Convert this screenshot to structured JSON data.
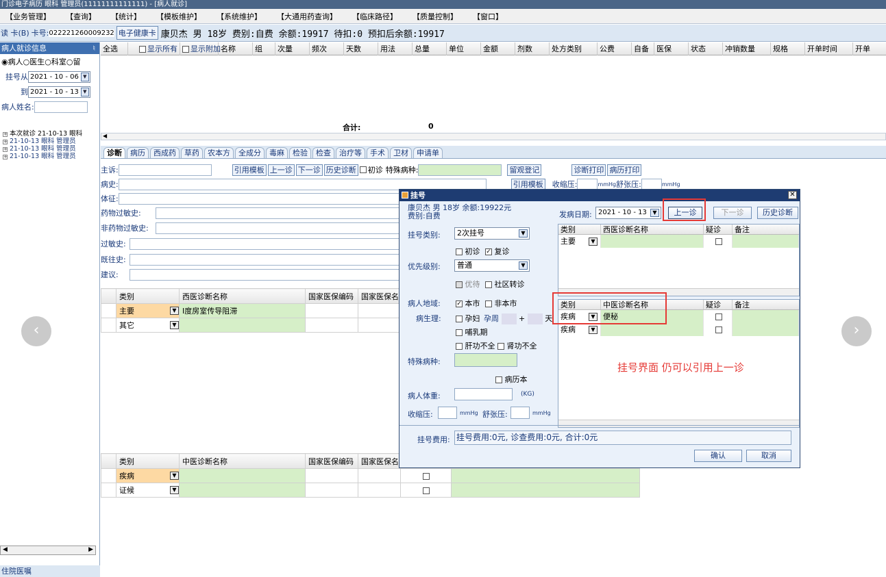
{
  "window": {
    "title": "门诊电子病历    眼科  管理员(11111111111111) - [病人就诊]"
  },
  "menu": [
    "【业务管理】",
    "【查询】",
    "【统计】",
    "【模板维护】",
    "【系统维护】",
    "【大通用药查询】",
    "【临床路径】",
    "【质量控制】",
    "【窗口】"
  ],
  "cardbar": {
    "read_card": "读 卡(B)",
    "card_no_label": "卡号:",
    "card_no": "022221260009232",
    "health_card_btn": "电子健康卡",
    "patient_info": "康贝杰 男 18岁 费别:自费 余额:19917 待扣:0 预扣后余额:19917"
  },
  "left": {
    "header": "病人就诊信息",
    "pin": "ᚑ",
    "radios": [
      "病人",
      "医生",
      "科室",
      "留"
    ],
    "reg_from_label": "挂号从",
    "reg_from": "2021 - 10 - 06",
    "reg_to_label": "到",
    "reg_to": "2021 - 10 - 13",
    "patient_name_label": "病人姓名:",
    "tree": [
      "本次就诊 21-10-13 眼科",
      "21-10-13 眼科 管理员",
      "21-10-13 眼科 管理员",
      "21-10-13 眼科 管理员"
    ],
    "footer": "住院医嘱"
  },
  "rx_grid": {
    "select_all": "全选",
    "show_all": "显示所有",
    "show_extra": "显示附加",
    "columns": [
      "名称",
      "组",
      "次量",
      "频次",
      "天数",
      "用法",
      "总量",
      "单位",
      "金额",
      "剂数",
      "处方类别",
      "公费",
      "自备",
      "医保",
      "状态",
      "冲销数量",
      "规格",
      "开单时间",
      "开单"
    ],
    "total_label": "合计:",
    "total_value": "0"
  },
  "tabs": [
    "诊断",
    "病历",
    "西成药",
    "草药",
    "农本方",
    "全成分",
    "毒麻",
    "检验",
    "检查",
    "治疗等",
    "手术",
    "卫材",
    "申请单"
  ],
  "form": {
    "complaint_label": "主诉:",
    "btn_template": "引用模板",
    "btn_prev": "上一诊",
    "btn_next": "下一诊",
    "btn_history": "历史诊断",
    "first_visit": "初诊",
    "special_label": "特殊病种:",
    "btn_observe": "留观登记",
    "btn_diag_print": "诊断打印",
    "btn_record_print": "病历打印",
    "history_label": "病史:",
    "btn_template2": "引用模板",
    "bp_sys_label": "收缩压:",
    "mmhg": "mmHg",
    "bp_dia_label": "舒张压:",
    "syndrome_label": "体征:",
    "drug_allergy_label": "药物过敏史:",
    "nondrug_allergy_label": "非药物过敏史:",
    "allergy_label": "过敏史:",
    "past_label": "既往史:",
    "advice_label": "建议:"
  },
  "west_diag": {
    "columns": [
      "类别",
      "西医诊断名称",
      "国家医保编码",
      "国家医保名"
    ],
    "rows": [
      {
        "type": "主要",
        "name": "Ⅰ度房室传导阻滞"
      },
      {
        "type": "其它",
        "name": ""
      }
    ]
  },
  "tcm_diag": {
    "columns": [
      "类别",
      "中医诊断名称",
      "国家医保编码",
      "国家医保名"
    ],
    "rows": [
      {
        "type": "疾病"
      },
      {
        "type": "证候"
      }
    ]
  },
  "dialog": {
    "title": "挂号",
    "close": "✕",
    "patient_line1": "康贝杰 男 18岁 余额:19922元",
    "patient_line2": "费别:自费",
    "onset_label": "发病日期:",
    "onset_date": "2021 - 10 - 13",
    "btn_prev": "上一诊",
    "btn_next": "下一诊",
    "btn_history": "历史诊断",
    "reg_type_label": "挂号类别:",
    "reg_type": "2次挂号",
    "first": "初诊",
    "revisit": "复诊",
    "priority_label": "优先级别:",
    "priority": "普通",
    "vip": "优待",
    "community": "社区转诊",
    "region_label": "病人地域:",
    "local": "本市",
    "nonlocal": "非本市",
    "physio_label": "病生理:",
    "pregnant": "孕妇",
    "gest_label": "孕周",
    "plus": "+",
    "days": "天",
    "lactation": "哺乳期",
    "liver": "肝功不全",
    "kidney": "肾功不全",
    "special_label": "特殊病种:",
    "record_book": "病历本",
    "weight_label": "病人体重:",
    "kg": "(KG)",
    "bp_sys_label": "收缩压:",
    "bp_dia_label": "舒张压:",
    "mmhg": "mmHg",
    "west_cols": [
      "类别",
      "西医诊断名称",
      "疑诊",
      "备注"
    ],
    "west_rows": [
      {
        "type": "主要",
        "name": ""
      }
    ],
    "tcm_cols": [
      "类别",
      "中医诊断名称",
      "疑诊",
      "备注"
    ],
    "tcm_rows": [
      {
        "type": "疾病",
        "name": "便秘"
      },
      {
        "type": "疾病",
        "name": ""
      }
    ],
    "fee_label": "挂号费用:",
    "fee_text": "挂号费用:0元, 诊查费用:0元, 合计:0元",
    "ok": "确认",
    "cancel": "取消"
  },
  "annotation": "挂号界面 仍可以引用上一诊",
  "colors": {
    "accent_red": "#e53935",
    "grid_green": "#d6efc8",
    "selected_orange": "#fdd9a3",
    "title_blue": "#1e3c72"
  }
}
